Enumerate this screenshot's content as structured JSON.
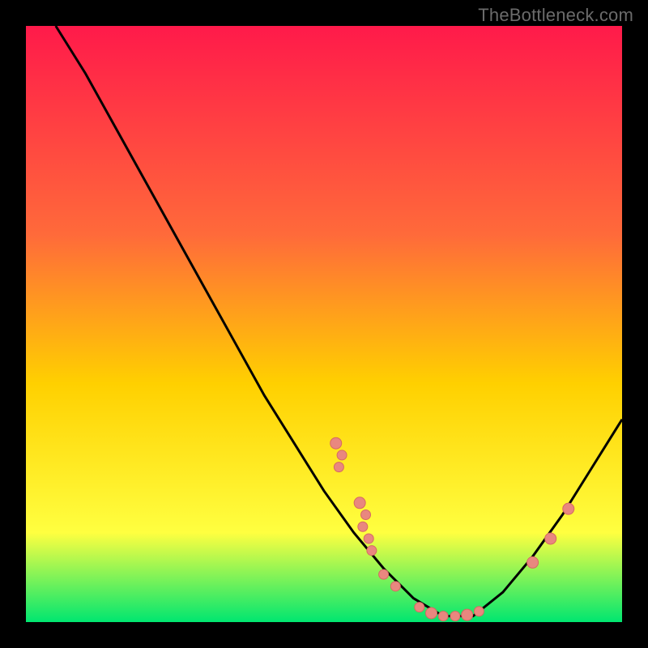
{
  "watermark": "TheBottleneck.com",
  "colors": {
    "gradient_top": "#ff1a4a",
    "gradient_mid1": "#ff6a3a",
    "gradient_mid2": "#ffd000",
    "gradient_mid3": "#ffff40",
    "gradient_bottom": "#00e670",
    "curve": "#000000",
    "marker_fill": "#e9877f",
    "marker_stroke": "#d66a62",
    "frame": "#000000"
  },
  "chart_data": {
    "type": "line",
    "title": "",
    "xlabel": "",
    "ylabel": "",
    "xlim": [
      0,
      100
    ],
    "ylim": [
      0,
      100
    ],
    "series": [
      {
        "name": "curve",
        "points": [
          {
            "x": 5,
            "y": 100
          },
          {
            "x": 10,
            "y": 92
          },
          {
            "x": 15,
            "y": 83
          },
          {
            "x": 20,
            "y": 74
          },
          {
            "x": 25,
            "y": 65
          },
          {
            "x": 30,
            "y": 56
          },
          {
            "x": 35,
            "y": 47
          },
          {
            "x": 40,
            "y": 38
          },
          {
            "x": 45,
            "y": 30
          },
          {
            "x": 50,
            "y": 22
          },
          {
            "x": 55,
            "y": 15
          },
          {
            "x": 60,
            "y": 9
          },
          {
            "x": 65,
            "y": 4
          },
          {
            "x": 70,
            "y": 1
          },
          {
            "x": 75,
            "y": 1
          },
          {
            "x": 80,
            "y": 5
          },
          {
            "x": 85,
            "y": 11
          },
          {
            "x": 90,
            "y": 18
          },
          {
            "x": 95,
            "y": 26
          },
          {
            "x": 100,
            "y": 34
          }
        ]
      }
    ],
    "markers": [
      {
        "x": 52,
        "y": 30,
        "r": 7
      },
      {
        "x": 53,
        "y": 28,
        "r": 6
      },
      {
        "x": 52.5,
        "y": 26,
        "r": 6
      },
      {
        "x": 56,
        "y": 20,
        "r": 7
      },
      {
        "x": 57,
        "y": 18,
        "r": 6
      },
      {
        "x": 56.5,
        "y": 16,
        "r": 6
      },
      {
        "x": 57.5,
        "y": 14,
        "r": 6
      },
      {
        "x": 58,
        "y": 12,
        "r": 6
      },
      {
        "x": 60,
        "y": 8,
        "r": 6
      },
      {
        "x": 62,
        "y": 6,
        "r": 6
      },
      {
        "x": 66,
        "y": 2.5,
        "r": 6
      },
      {
        "x": 68,
        "y": 1.5,
        "r": 7
      },
      {
        "x": 70,
        "y": 1,
        "r": 6
      },
      {
        "x": 72,
        "y": 1,
        "r": 6
      },
      {
        "x": 74,
        "y": 1.2,
        "r": 7
      },
      {
        "x": 76,
        "y": 1.8,
        "r": 6
      },
      {
        "x": 85,
        "y": 10,
        "r": 7
      },
      {
        "x": 88,
        "y": 14,
        "r": 7
      },
      {
        "x": 91,
        "y": 19,
        "r": 7
      }
    ]
  }
}
